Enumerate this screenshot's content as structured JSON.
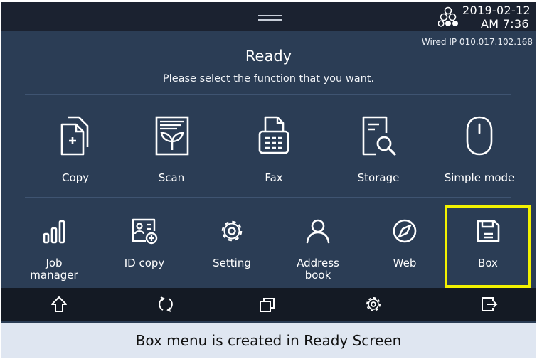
{
  "status_bar": {
    "date": "2019-02-12",
    "time": "AM 7:36",
    "network_icon": "network-status-icon",
    "ip_label": "Wired IP 010.017.102.168"
  },
  "main": {
    "title": "Ready",
    "subtitle": "Please select the function that you want."
  },
  "row1": [
    {
      "label": "Copy",
      "icon": "copy-icon"
    },
    {
      "label": "Scan",
      "icon": "scan-icon"
    },
    {
      "label": "Fax",
      "icon": "fax-icon"
    },
    {
      "label": "Storage",
      "icon": "storage-icon"
    },
    {
      "label": "Simple mode",
      "icon": "simple-mode-icon"
    }
  ],
  "row2": [
    {
      "label_line1": "Job",
      "label_line2": "manager",
      "icon": "job-manager-icon"
    },
    {
      "label_line1": "ID copy",
      "label_line2": "",
      "icon": "id-copy-icon"
    },
    {
      "label_line1": "Setting",
      "label_line2": "",
      "icon": "setting-icon"
    },
    {
      "label_line1": "Address",
      "label_line2": "book",
      "icon": "address-book-icon"
    },
    {
      "label_line1": "Web",
      "label_line2": "",
      "icon": "web-icon"
    },
    {
      "label_line1": "Box",
      "label_line2": "",
      "icon": "box-icon",
      "highlighted": true
    }
  ],
  "navbar": [
    "home-icon",
    "reset-icon",
    "multitask-icon",
    "settings-icon",
    "logout-icon"
  ],
  "colors": {
    "panel_bg": "#2b3d55",
    "top_bar_bg": "#1b2230",
    "nav_bar_bg": "#141a24",
    "highlight": "#f2f200",
    "caption_bg": "#dfe6f1"
  },
  "caption": "Box menu is created in Ready Screen"
}
